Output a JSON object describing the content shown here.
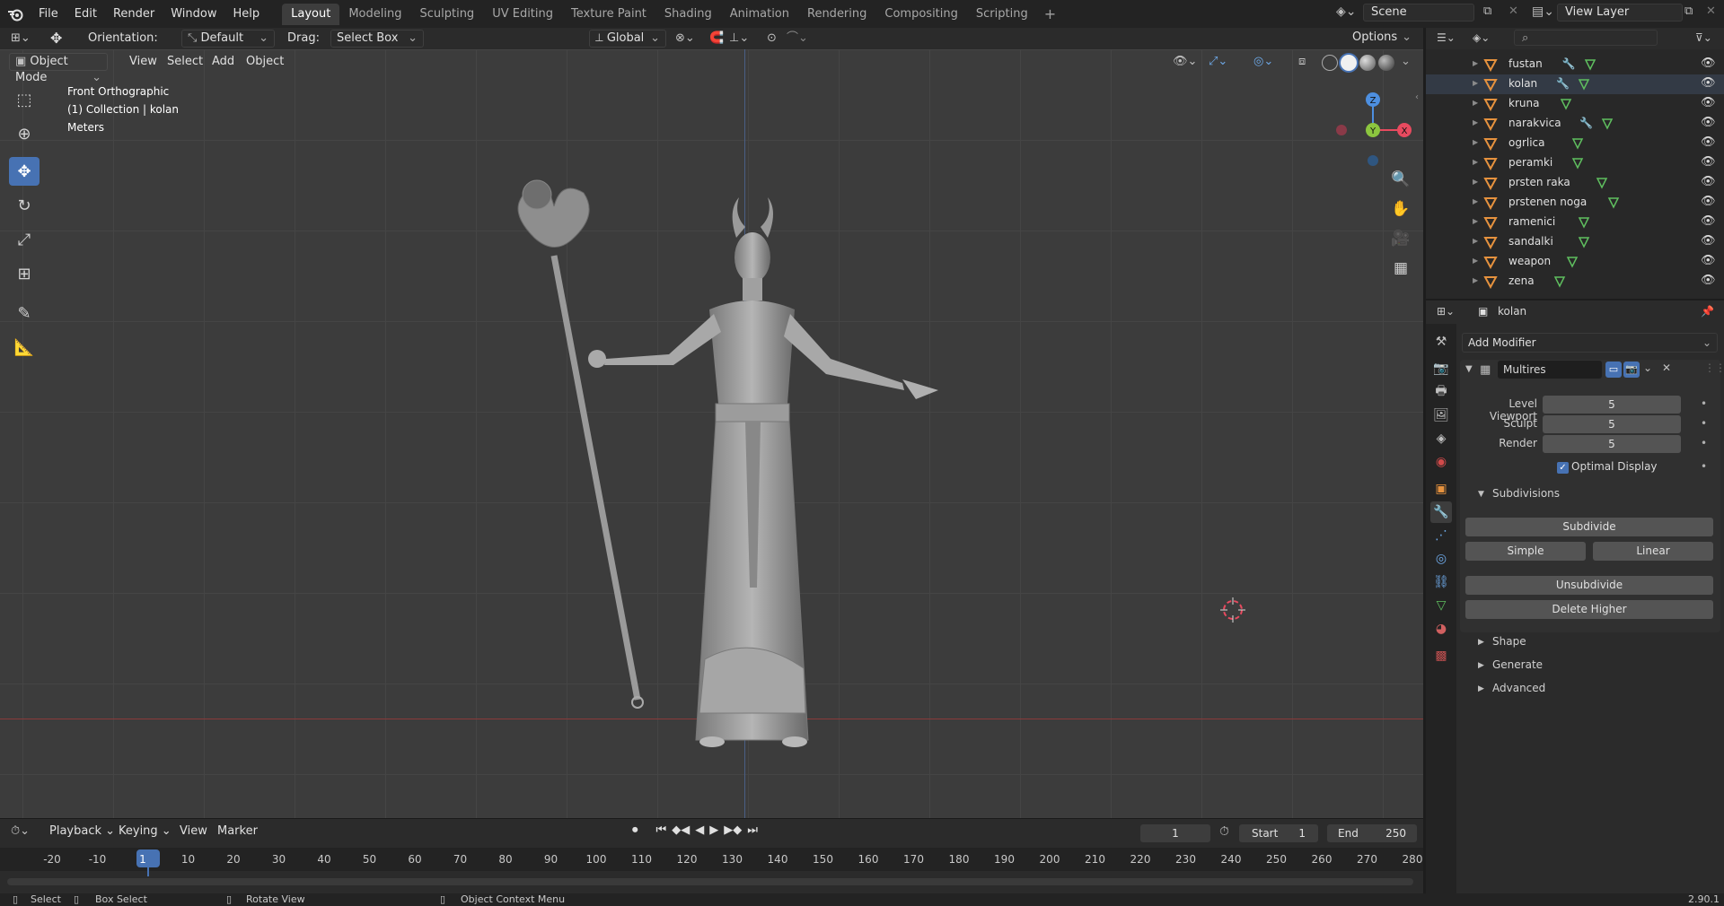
{
  "topbar": {
    "menus": [
      "File",
      "Edit",
      "Render",
      "Window",
      "Help"
    ],
    "workspaces": [
      "Layout",
      "Modeling",
      "Sculpting",
      "UV Editing",
      "Texture Paint",
      "Shading",
      "Animation",
      "Rendering",
      "Compositing",
      "Scripting"
    ],
    "active_workspace": "Layout",
    "scene": "Scene",
    "view_layer": "View Layer"
  },
  "header": {
    "orientation_label": "Orientation:",
    "orientation_value": "Default",
    "drag_label": "Drag:",
    "drag_value": "Select Box",
    "transform_orientation": "Global",
    "options": "Options"
  },
  "viewport_header": {
    "mode": "Object Mode",
    "menus": [
      "View",
      "Select",
      "Add",
      "Object"
    ]
  },
  "overlay_text": {
    "view_name": "Front Orthographic",
    "collection": "(1) Collection | kolan",
    "units": "Meters"
  },
  "gizmo": {
    "z": "Z",
    "y": "Y",
    "x": "X"
  },
  "outliner": {
    "items": [
      {
        "name": "fustan",
        "modifier": true
      },
      {
        "name": "kolan",
        "modifier": true
      },
      {
        "name": "kruna",
        "modifier": false
      },
      {
        "name": "narakvica",
        "modifier": true
      },
      {
        "name": "ogrlica",
        "modifier": false
      },
      {
        "name": "peramki",
        "modifier": false
      },
      {
        "name": "prsten raka",
        "modifier": false
      },
      {
        "name": "prstenen noga",
        "modifier": false
      },
      {
        "name": "ramenici",
        "modifier": false
      },
      {
        "name": "sandalki",
        "modifier": false
      },
      {
        "name": "weapon",
        "modifier": false
      },
      {
        "name": "zena",
        "modifier": false
      }
    ]
  },
  "properties": {
    "object_name": "kolan",
    "add_modifier": "Add Modifier",
    "modifier_name": "Multires",
    "level_viewport_label": "Level Viewport",
    "level_viewport": "5",
    "sculpt_label": "Sculpt",
    "sculpt": "5",
    "render_label": "Render",
    "render": "5",
    "optimal_display": "Optimal Display",
    "subdivisions_label": "Subdivisions",
    "subdivide": "Subdivide",
    "simple": "Simple",
    "linear": "Linear",
    "unsubdivide": "Unsubdivide",
    "delete_higher": "Delete Higher",
    "shape": "Shape",
    "generate": "Generate",
    "advanced": "Advanced"
  },
  "timeline": {
    "menus": [
      "Playback",
      "Keying",
      "View",
      "Marker"
    ],
    "current_frame": "1",
    "start_label": "Start",
    "start": "1",
    "end_label": "End",
    "end": "250",
    "ticks": [
      "-20",
      "-10",
      "1",
      "10",
      "20",
      "30",
      "40",
      "50",
      "60",
      "70",
      "80",
      "90",
      "100",
      "110",
      "120",
      "130",
      "140",
      "150",
      "160",
      "170",
      "180",
      "190",
      "200",
      "210",
      "220",
      "230",
      "240",
      "250",
      "260",
      "270",
      "280"
    ]
  },
  "status": {
    "select": "Select",
    "box_select": "Box Select",
    "rotate_view": "Rotate View",
    "context_menu": "Object Context Menu",
    "version": "2.90.1"
  },
  "colors": {
    "accent": "#4772b3",
    "mesh_orange": "#e6923e",
    "modifier_blue": "#6ea9e8",
    "vertex_green": "#5fbf5f",
    "axis_x": "#e84a5f",
    "axis_y": "#8cc63f",
    "axis_z": "#4d8fe0"
  }
}
